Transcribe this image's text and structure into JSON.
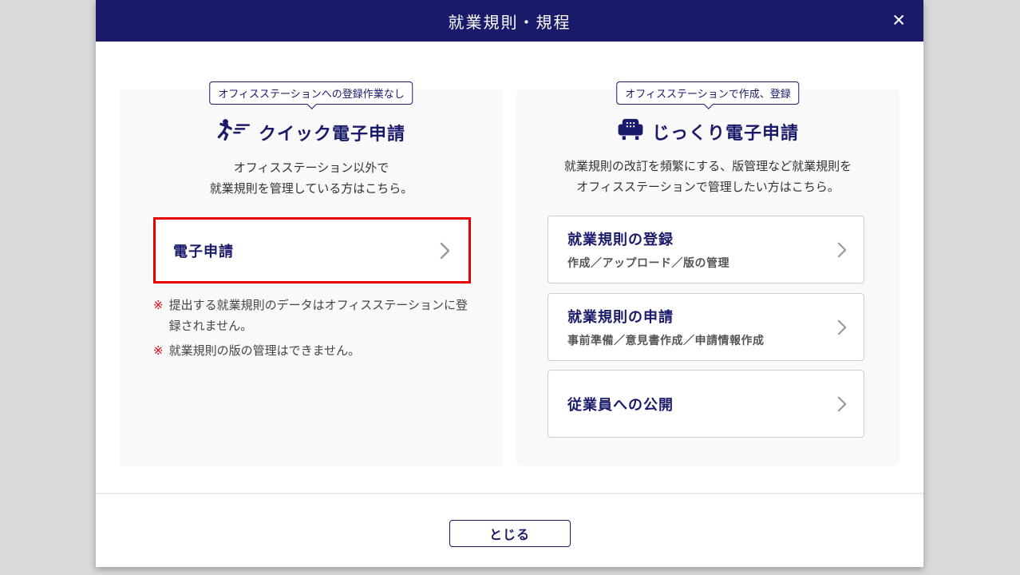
{
  "header": {
    "title": "就業規則・規程",
    "close_icon": "✕"
  },
  "left_panel": {
    "badge": "オフィスステーションへの登録作業なし",
    "icon": "running-person-icon",
    "title": "クイック電子申請",
    "description_line1": "オフィスステーション以外で",
    "description_line2": "就業規則を管理している方はこちら。",
    "button": {
      "label": "電子申請"
    },
    "notes": [
      {
        "marker": "※",
        "text": "提出する就業規則のデータはオフィスステーションに登録されません。"
      },
      {
        "marker": "※",
        "text": "就業規則の版の管理はできません。"
      }
    ]
  },
  "right_panel": {
    "badge": "オフィスステーションで作成、登録",
    "icon": "sofa-icon",
    "title": "じっくり電子申請",
    "description_line1": "就業規則の改訂を頻繁にする、版管理など就業規則を",
    "description_line2": "オフィスステーションで管理したい方はこちら。",
    "buttons": [
      {
        "title": "就業規則の登録",
        "subtitle": "作成／アップロード／版の管理"
      },
      {
        "title": "就業規則の申請",
        "subtitle": "事前準備／意見書作成／申請情報作成"
      },
      {
        "title": "従業員への公開",
        "subtitle": ""
      }
    ]
  },
  "footer": {
    "close_label": "とじる"
  },
  "colors": {
    "navy": "#1a1a6b",
    "highlight_red": "#e60000",
    "note_marker_red": "#e60012",
    "panel_bg": "#f9f9f9",
    "page_bg": "#d9d9d9",
    "chevron_gray": "#999999"
  }
}
